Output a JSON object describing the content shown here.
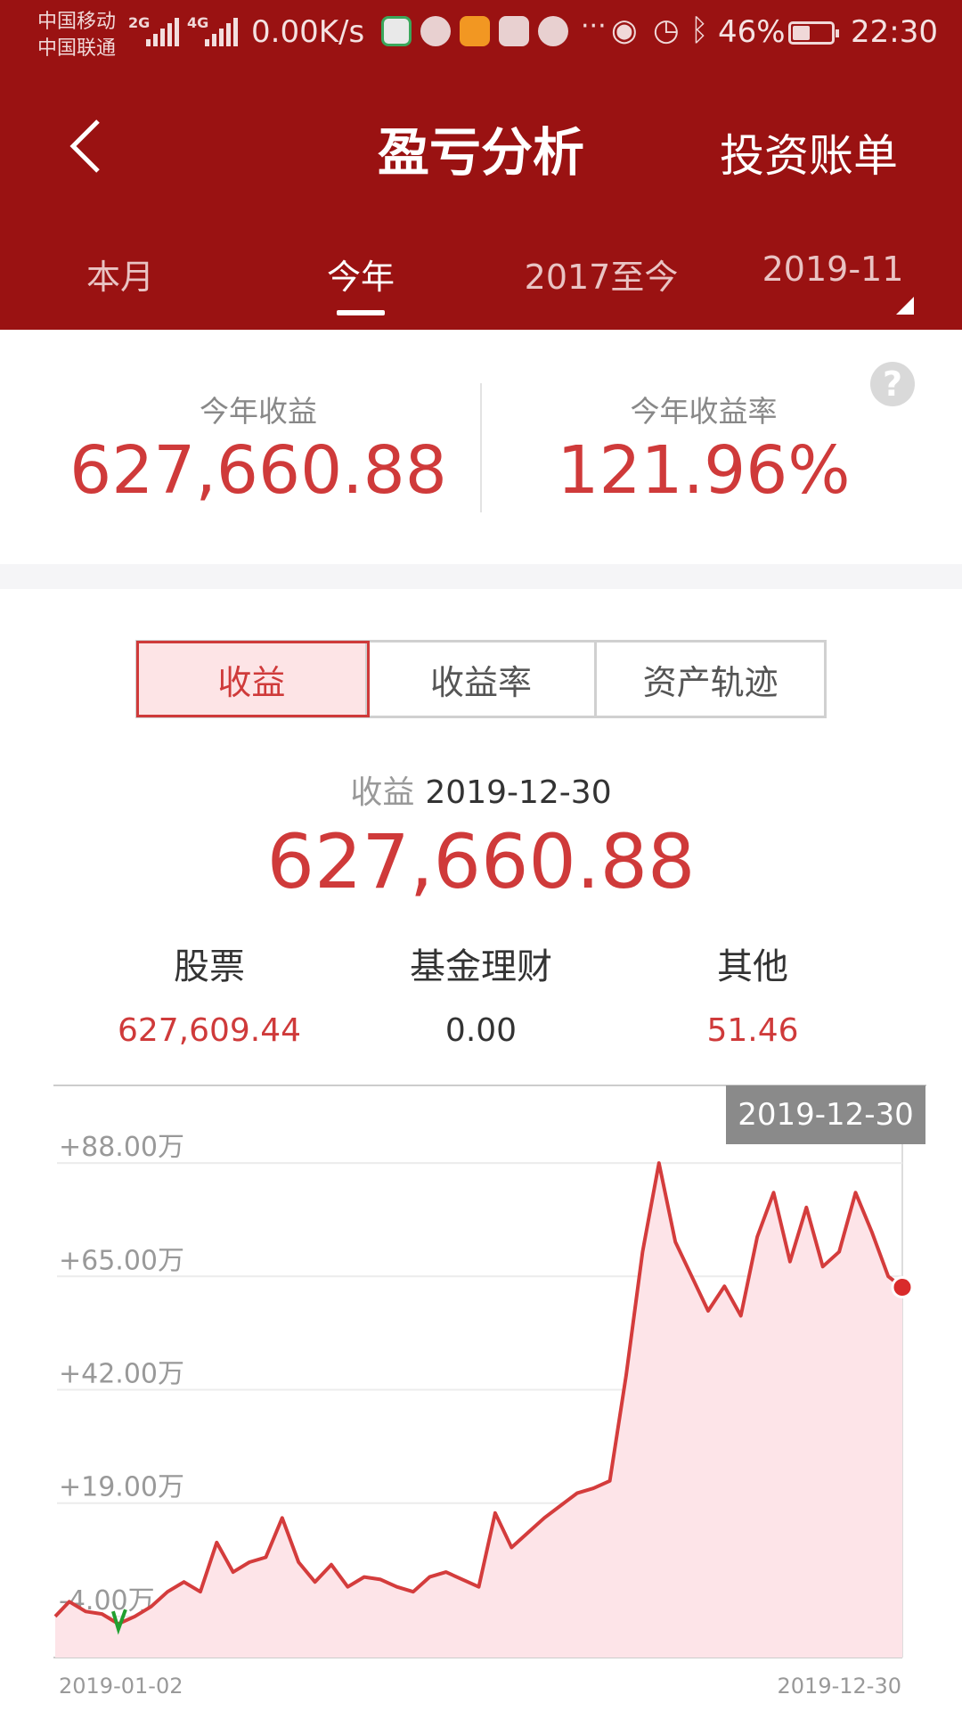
{
  "status_bar": {
    "carrier1": "中国移动",
    "carrier2": "中国联通",
    "sig1_tag": "2G",
    "sig2_tag": "4G",
    "net_speed": "0.00K/s",
    "battery_percent": "46%",
    "battery_level": 0.46,
    "time": "22:30"
  },
  "header": {
    "title": "盈亏分析",
    "right_link": "投资账单"
  },
  "tabs": [
    {
      "label": "本月",
      "active": false
    },
    {
      "label": "今年",
      "active": true
    },
    {
      "label": "2017至今",
      "active": false
    },
    {
      "label": "2019-11",
      "active": false
    }
  ],
  "summary": {
    "profit_label": "今年收益",
    "profit_value": "627,660.88",
    "rate_label": "今年收益率",
    "rate_value": "121.96%",
    "help": "?"
  },
  "segments": [
    {
      "label": "收益",
      "active": true
    },
    {
      "label": "收益率",
      "active": false
    },
    {
      "label": "资产轨迹",
      "active": false
    }
  ],
  "detail": {
    "label": "收益",
    "date": "2019-12-30",
    "value": "627,660.88"
  },
  "categories": [
    {
      "name": "股票",
      "value": "627,609.44",
      "tone": "red"
    },
    {
      "name": "基金理财",
      "value": "0.00",
      "tone": "dark"
    },
    {
      "name": "其他",
      "value": "51.46",
      "tone": "red"
    }
  ],
  "colors": {
    "header_bg": "#9a1212",
    "accent_red": "#cf3a3a",
    "line_red": "#d43c3c",
    "area_fill": "#fde4e8",
    "loss_green": "#20a030"
  },
  "chart_data": {
    "type": "area",
    "y_tick_labels": [
      "+88.00万",
      "+65.00万",
      "+42.00万",
      "+19.00万",
      "-4.00万"
    ],
    "y_ticks": [
      88,
      65,
      42,
      19,
      -4
    ],
    "x_tick_labels": [
      "2019-01-02",
      "2019-12-30"
    ],
    "x_range": [
      "2019-01-02",
      "2019-12-30"
    ],
    "ylim": [
      -8,
      92
    ],
    "y_unit": "万",
    "grid": true,
    "tooltip_date": "2019-12-30",
    "series": [
      {
        "x": [
          "2019-01-02",
          "2019-01-08",
          "2019-01-15",
          "2019-01-22",
          "2019-01-29",
          "2019-02-05",
          "2019-02-12",
          "2019-02-19",
          "2019-02-26",
          "2019-03-05",
          "2019-03-12",
          "2019-03-19",
          "2019-03-26",
          "2019-04-02",
          "2019-04-09",
          "2019-04-16",
          "2019-04-23",
          "2019-04-30",
          "2019-05-07",
          "2019-05-14",
          "2019-05-21",
          "2019-05-28",
          "2019-06-04",
          "2019-06-11",
          "2019-06-18",
          "2019-06-25",
          "2019-07-02",
          "2019-07-09",
          "2019-07-16",
          "2019-07-23",
          "2019-07-30",
          "2019-08-06",
          "2019-08-13",
          "2019-08-20",
          "2019-08-27",
          "2019-09-03",
          "2019-09-10",
          "2019-09-17",
          "2019-09-24",
          "2019-10-01",
          "2019-10-08",
          "2019-10-15",
          "2019-10-22",
          "2019-10-29",
          "2019-11-05",
          "2019-11-12",
          "2019-11-19",
          "2019-11-26",
          "2019-12-03",
          "2019-12-10",
          "2019-12-17",
          "2019-12-24",
          "2019-12-30"
        ],
        "values": [
          -4.0,
          -1.0,
          -3.0,
          -3.5,
          -5.5,
          -4.0,
          -2.0,
          1.0,
          3.0,
          1.0,
          11.0,
          5.0,
          7.0,
          8.0,
          16.0,
          7.0,
          3.0,
          6.5,
          2.0,
          4.0,
          3.5,
          2.0,
          1.0,
          4.0,
          5.0,
          3.5,
          2.0,
          17.0,
          10.0,
          13.0,
          16.0,
          18.5,
          21.0,
          22.0,
          23.5,
          45.0,
          70.0,
          88.0,
          72.0,
          65.0,
          58.0,
          63.0,
          57.0,
          73.0,
          82.0,
          68.0,
          79.0,
          67.0,
          70.0,
          82.0,
          74.0,
          65.0,
          62.8
        ],
        "last_value": 62.77,
        "color": "#d43c3c"
      }
    ]
  }
}
